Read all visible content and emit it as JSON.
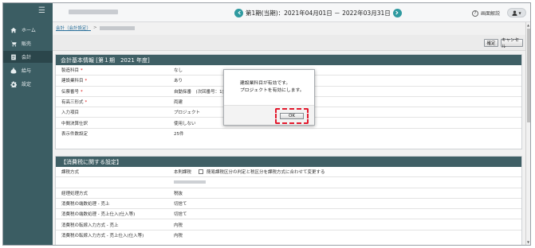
{
  "sidebar": {
    "menu_icon": "hamburger-icon",
    "items": [
      {
        "label": "ホーム",
        "icon": "home-icon"
      },
      {
        "label": "販売",
        "icon": "cart-icon"
      },
      {
        "label": "会計",
        "icon": "ledger-icon",
        "active": true
      },
      {
        "label": "給与",
        "icon": "money-bag-icon"
      },
      {
        "label": "設定",
        "icon": "gear-icon"
      }
    ]
  },
  "header": {
    "period_text": "第1期(当期)：2021年04月01日 － 2022年03月31日",
    "help_label": "画面解説",
    "user_icon": "user-icon"
  },
  "breadcrumb": {
    "link": "会計（会計設定）",
    "separator": ">"
  },
  "actions": {
    "confirm": "確定",
    "cancel": "キャンセル"
  },
  "section1": {
    "title": "会計基本情報 [第１期　2021 年度]",
    "rows": [
      {
        "label": "製造科目",
        "required": true,
        "value": "なし"
      },
      {
        "label": "建設業科目",
        "required": true,
        "value": "あり"
      },
      {
        "label": "伝票番号",
        "required": true,
        "value": "自動採番　(次回番号：1)"
      },
      {
        "label": "有高三形式",
        "required": true,
        "value": "両建"
      },
      {
        "label": "入力項目",
        "required": false,
        "value": "プロジェクト"
      },
      {
        "label": "中間決算仕訳",
        "required": false,
        "value": "使用しない"
      },
      {
        "label": "表示件数設定",
        "required": false,
        "value": "25件"
      }
    ]
  },
  "section2": {
    "title": "【消費税に関する設定】",
    "rows": [
      {
        "label": "課税方式",
        "value": "本則課税",
        "checkbox_label": "簡易課税区分の判定と税区分を課税方式に合わせて変更する"
      },
      {
        "label": "",
        "value": ""
      },
      {
        "label": "経理処理方式",
        "value": "税抜"
      },
      {
        "label": "消費税の端数処理 - 売上",
        "value": "切捨て"
      },
      {
        "label": "消費税の端数処理 - 売上仕入(仕入等)",
        "value": "切捨て"
      },
      {
        "label": "消費税の転嫁入力方式 - 売上",
        "value": "内税"
      },
      {
        "label": "消費税の転嫁入力方式 - 売上仕入(仕入等)",
        "value": "内税"
      }
    ]
  },
  "dialog": {
    "line1": "建設業科目が有効です。",
    "line2": "プロジェクトを有効にします。",
    "ok": "OK"
  },
  "colors": {
    "sidebar": "#3b5d63",
    "section_header": "#3f5f65",
    "accent": "#2f9aa0",
    "highlight": "#e3192d"
  }
}
